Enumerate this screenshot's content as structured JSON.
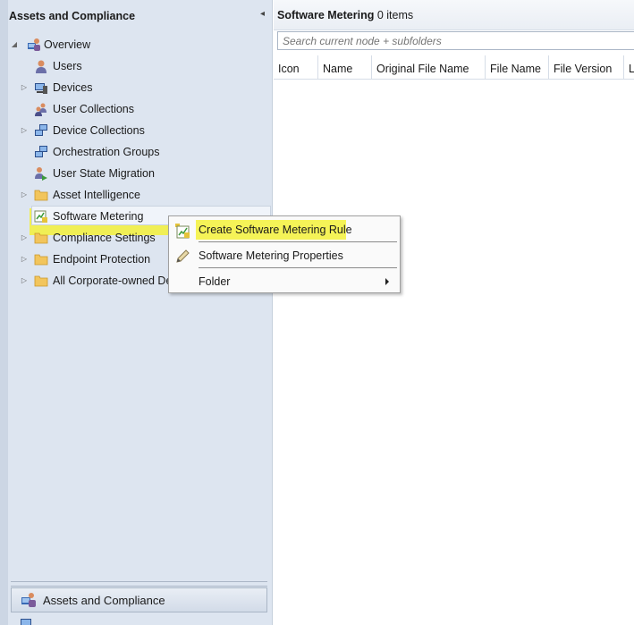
{
  "nav": {
    "header": "Assets and Compliance",
    "collapse_icon": "chevron-left",
    "tree": [
      {
        "label": "Overview",
        "icon": "overview-icon",
        "expander": "expanded"
      },
      {
        "label": "Users",
        "icon": "user-icon",
        "expander": "none"
      },
      {
        "label": "Devices",
        "icon": "devices-icon",
        "expander": "collapsed"
      },
      {
        "label": "User Collections",
        "icon": "user-collections-icon",
        "expander": "none"
      },
      {
        "label": "Device Collections",
        "icon": "device-collections-icon",
        "expander": "collapsed"
      },
      {
        "label": "Orchestration Groups",
        "icon": "orchestration-groups-icon",
        "expander": "none"
      },
      {
        "label": "User State Migration",
        "icon": "user-state-migration-icon",
        "expander": "none"
      },
      {
        "label": "Asset Intelligence",
        "icon": "folder-icon",
        "expander": "collapsed"
      },
      {
        "label": "Software Metering",
        "icon": "software-metering-icon",
        "expander": "none",
        "selected": true
      },
      {
        "label": "Compliance Settings",
        "icon": "folder-icon",
        "expander": "collapsed"
      },
      {
        "label": "Endpoint Protection",
        "icon": "folder-icon",
        "expander": "collapsed"
      },
      {
        "label": "All Corporate-owned Devices",
        "icon": "folder-icon",
        "expander": "collapsed"
      }
    ],
    "bottom_button": "Assets and Compliance"
  },
  "content": {
    "title_bold": "Software Metering",
    "title_count": "0 items",
    "search_placeholder": "Search current node + subfolders",
    "columns": [
      "Icon",
      "Name",
      "Original File Name",
      "File Name",
      "File Version",
      "Language"
    ]
  },
  "context_menu": {
    "items": [
      {
        "label": "Create Software Metering Rule",
        "icon": "create-rule-icon"
      },
      {
        "label": "Software Metering Properties",
        "icon": "pencil-icon"
      },
      {
        "label": "Folder",
        "icon": "",
        "submenu": true
      }
    ]
  },
  "colors": {
    "highlight": "#f3f13a",
    "nav_background": "#dde5f0",
    "folder": "#f2c55c"
  }
}
